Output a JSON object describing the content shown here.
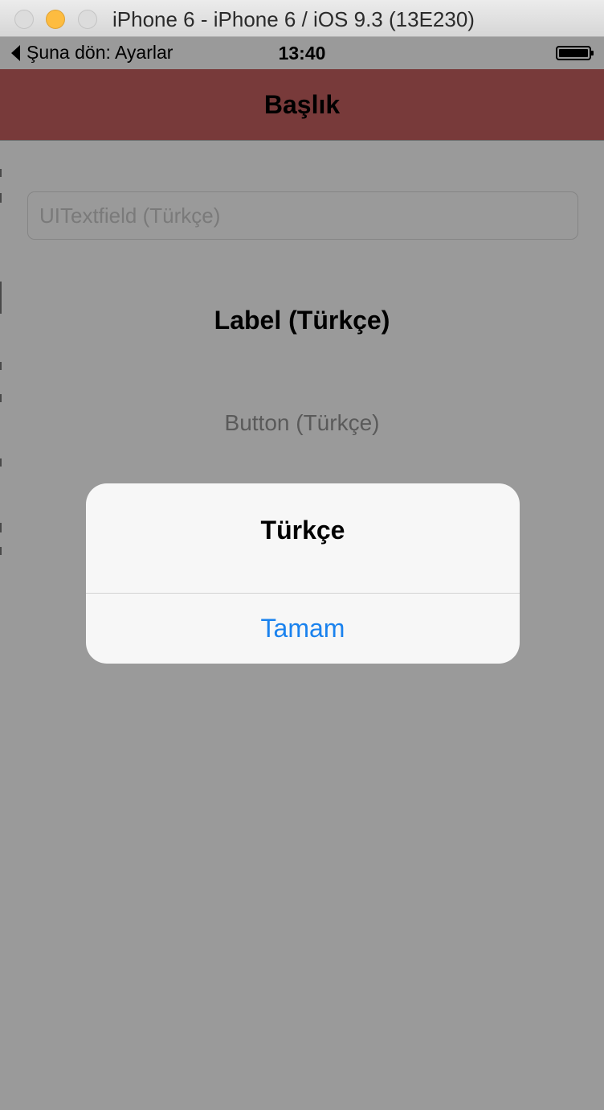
{
  "window": {
    "title": "iPhone 6 - iPhone 6 / iOS 9.3 (13E230)"
  },
  "status_bar": {
    "back_label": "Şuna dön: Ayarlar",
    "time": "13:40"
  },
  "nav_bar": {
    "title": "Başlık",
    "color": "#783a3a"
  },
  "content": {
    "textfield_placeholder": "UITextfield (Türkçe)",
    "label": "Label (Türkçe)",
    "button_label": "Button (Türkçe)"
  },
  "alert": {
    "title": "Türkçe",
    "ok_label": "Tamam",
    "ok_color": "#1a82ee"
  },
  "icons": {
    "back": "chevron-left-icon",
    "battery": "battery-icon"
  }
}
